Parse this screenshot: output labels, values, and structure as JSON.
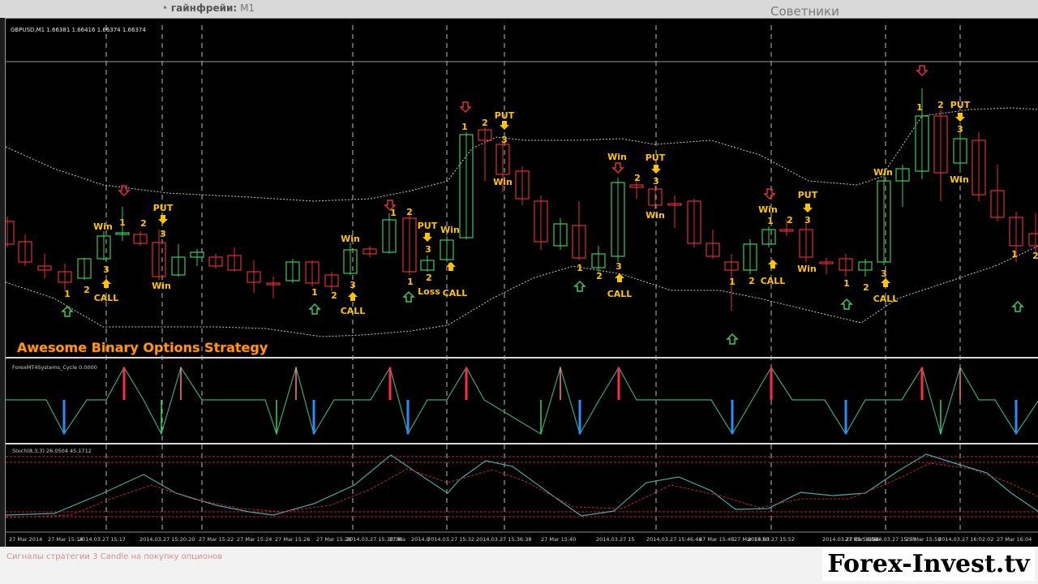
{
  "browser": {
    "crumb_prefix": "•",
    "crumb_title": "гайнфрейи:",
    "crumb_value": "M1",
    "right_text": "Советники"
  },
  "chart_header": "GBPUSD,M1  1.66381 1.66416 1.66374 1.66374",
  "strategy_title": "Awesome Binary Options Strategy",
  "indicator1_label": "ForexMT4Systems_Cycle 0.0000",
  "indicator2_label": "Stoch(8,3,3) 26.0504 45.1712",
  "time_labels": [
    "27 Mar 2014",
    "27 Mar 15:14",
    "2014.03.27 15:17",
    "2014.03.27 15:20:20",
    "27 Mar 15:22",
    "27 Mar 15:24",
    "27 Mar 15:26",
    "27 Mar 15:28",
    "2014.03.27 15:30:30",
    "27 Ma",
    "2014.0",
    "2014.03.27 15:32",
    "2014.03.27 15:36:38",
    "27 Mar 15:40",
    "2014.03.27 15",
    "2014.03.27 15:46:46",
    "27 Mar 15:48",
    "27 Mar 15:50",
    "2014.03.27 15:52",
    "2014.03.27 15:54:54",
    "27 Mar 15:56",
    "2014.03.27 15:58",
    "27 Mar 15:58",
    "2014.03.27 16:02:02",
    "27 Mar 16:04"
  ],
  "caption": "Сигналы стратегии 3 Candle на покупку опционов",
  "brand": "Forex-Invest.tv",
  "colors": {
    "bull": "#3ccc5a",
    "bear": "#e0303a",
    "signal": "#ffc400",
    "band": "#c8c8c8",
    "cycle": "#3aa878",
    "cycle_red": "#ff2a4a",
    "cycle_blue": "#2a8cff",
    "stoch_main": "#4aa8a0",
    "stoch_signal": "#c02040"
  },
  "chart_data": {
    "type": "candlestick",
    "symbol": "GBPUSD",
    "timeframe": "M1",
    "header_ohlc": {
      "open": 1.66381,
      "high": 1.66416,
      "low": 1.66374,
      "close": 1.66374
    },
    "indicators": [
      "ForexMT4Systems_Cycle",
      "Stoch(8,3,3)"
    ],
    "stoch_values": [
      26.0504,
      45.1712
    ],
    "signal_text": [
      "1",
      "2",
      "3",
      "CALL",
      "PUT",
      "Win",
      "Loss"
    ]
  }
}
